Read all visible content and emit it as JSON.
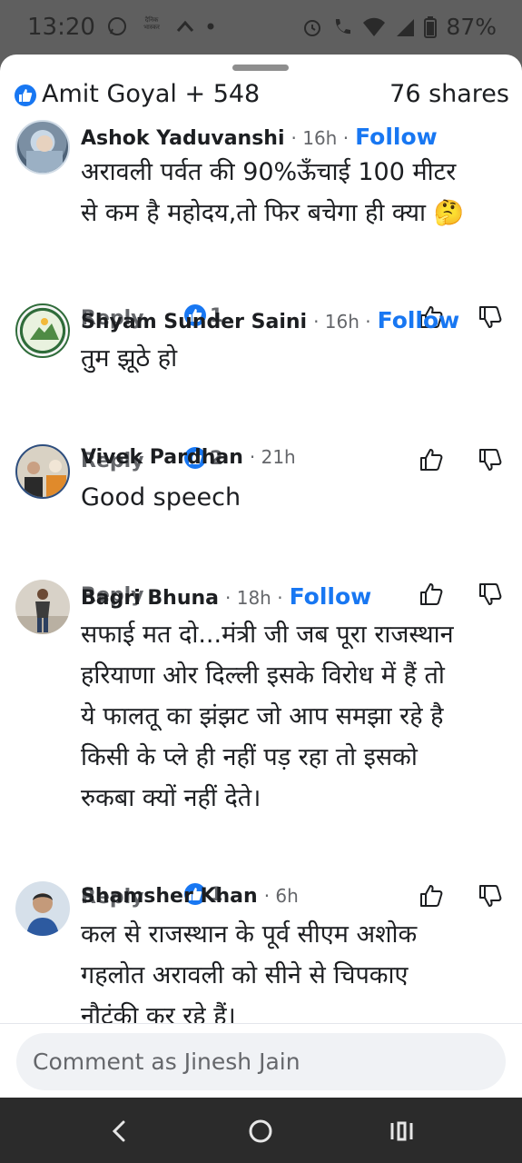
{
  "status_bar": {
    "time": "13:20",
    "battery": "87%",
    "news_badge": "दैनिक भास्कर"
  },
  "header": {
    "reactions": "Amit Goyal + 548",
    "shares": "76 shares"
  },
  "comments": [
    {
      "author": "Ashok Yaduvanshi",
      "time": "· 16h ·",
      "follow": "Follow",
      "text_lines": [
        "अरावली पर्वत की 90%ऊँचाई 100 मीटर",
        "से कम है महोदय,तो फिर बचेगा ही क्या 🤔"
      ],
      "reply": "Reply",
      "likes": "1"
    },
    {
      "author": "Shyam Sunder Saini",
      "time": "· 16h ·",
      "follow": "Follow",
      "text_lines": [
        "तुम झूठे हो"
      ],
      "reply": "Reply",
      "likes": "2"
    },
    {
      "author": "Vivek Pardhan",
      "time": "· 21h",
      "text_lines": [
        "Good speech"
      ],
      "reply": "Reply"
    },
    {
      "author": "Bagri Bhuna",
      "time": "· 18h ·",
      "follow": "Follow",
      "text_lines": [
        "सफाई मत दो...मंत्री जी जब पूरा राजस्थान",
        "हरियाणा ओर दिल्ली इसके विरोध में हैं तो",
        "ये फालतू का झंझट जो आप समझा रहे है",
        "किसी के प्ले ही नहीं पड़ रहा तो इसको",
        "रुकबा क्यों नहीं देते।"
      ],
      "reply": "Reply",
      "likes": "1"
    },
    {
      "author": "Shamsher Khan",
      "time": "· 6h",
      "text_lines": [
        "कल से राजस्थान के पूर्व सीएम अशोक",
        "गहलोत अरावली को सीने से चिपकाए",
        "नौटंकी कर रहे हैं।"
      ]
    }
  ],
  "comment_input": {
    "placeholder": "Comment as Jinesh Jain"
  },
  "colors": {
    "accent": "#1877f2",
    "text": "#1c1e21",
    "muted": "#65676b",
    "background_dim": "#5f5f5f",
    "nav_bar": "#2b2b2b"
  },
  "icons": [
    "whatsapp-icon",
    "chevron-up-icon",
    "dot-icon",
    "alarm-icon",
    "wifi-call-icon",
    "wifi-icon",
    "signal-icon",
    "battery-icon",
    "like-icon",
    "thumbs-up-icon",
    "thumbs-down-icon",
    "back-icon",
    "home-icon",
    "recents-icon"
  ]
}
